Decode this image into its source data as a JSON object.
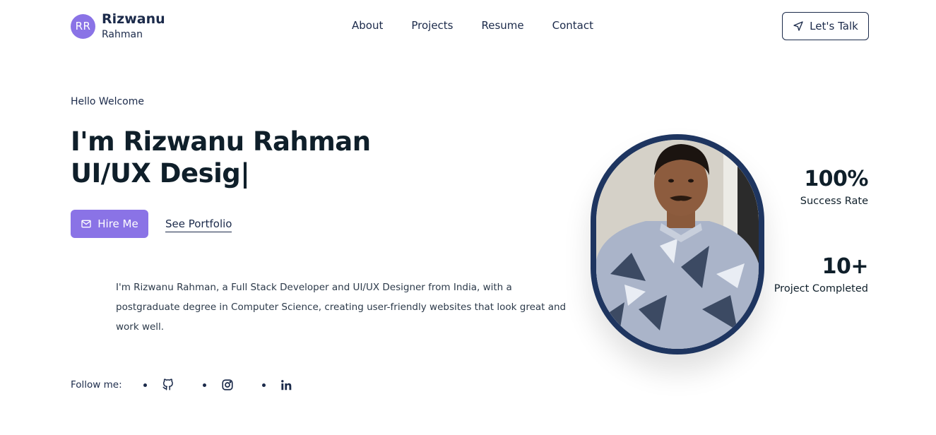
{
  "logo": {
    "initials": "RR",
    "first_name": "Rizwanu",
    "last_name": "Rahman"
  },
  "nav": {
    "items": [
      "About",
      "Projects",
      "Resume",
      "Contact"
    ]
  },
  "cta": {
    "lets_talk": "Let's Talk",
    "icon": "send-icon"
  },
  "hero": {
    "greeting": "Hello Welcome",
    "headline_line1": "I'm Rizwanu Rahman",
    "headline_line2": "UI/UX Desig",
    "caret": "|",
    "hire_label": "Hire Me",
    "portfolio_label": "See Portfolio",
    "bio": "I'm Rizwanu Rahman, a Full Stack Developer and UI/UX Designer from India, with a postgraduate degree in Computer Science, creating user-friendly websites that look great and work well."
  },
  "follow": {
    "label": "Follow me:",
    "icons": [
      "github-icon",
      "instagram-icon",
      "linkedin-icon"
    ]
  },
  "stats": [
    {
      "value": "100%",
      "label": "Success Rate"
    },
    {
      "value": "10+",
      "label": "Project Completed"
    }
  ],
  "colors": {
    "accent": "#8a73e6",
    "navy": "#1e3560",
    "text": "#1b2a4a"
  }
}
